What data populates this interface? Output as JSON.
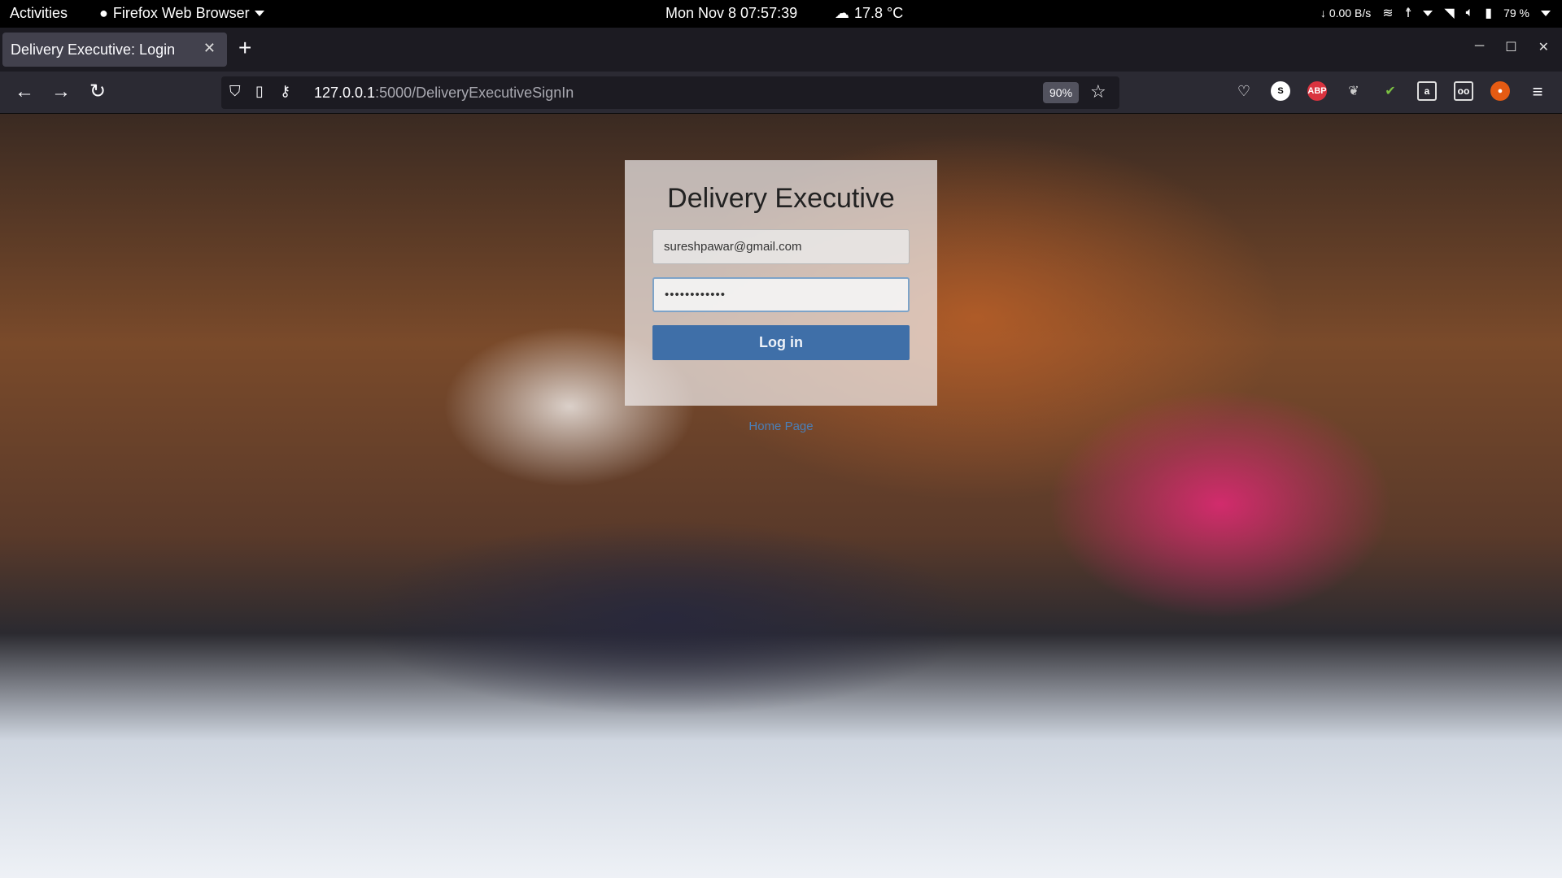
{
  "system_bar": {
    "activities": "Activities",
    "app_name": "Firefox Web Browser",
    "clock": "Mon Nov 8  07:57:39",
    "weather": "17.8 °C",
    "net_speed": "↓ 0.00 B/s",
    "battery": "79 %"
  },
  "browser": {
    "tab_title": "Delivery Executive: Login",
    "new_tab_symbol": "+",
    "url_host": "127.0.0.1",
    "url_path": ":5000/DeliveryExecutiveSignIn",
    "zoom": "90%",
    "extensions": [
      "pocket-icon",
      "s-extension-icon",
      "adblock-plus-icon",
      "dark-extension-icon",
      "green-extension-icon",
      "reader-extension-icon",
      "glasses-extension-icon",
      "fire-extension-icon"
    ]
  },
  "page": {
    "title": "Delivery Executive",
    "email_value": "sureshpawar@gmail.com",
    "password_value": "••••••••••••",
    "login_label": "Log in",
    "home_link": "Home Page"
  },
  "colors": {
    "login_button": "#3f6fa8",
    "link": "#4a7fb8"
  }
}
